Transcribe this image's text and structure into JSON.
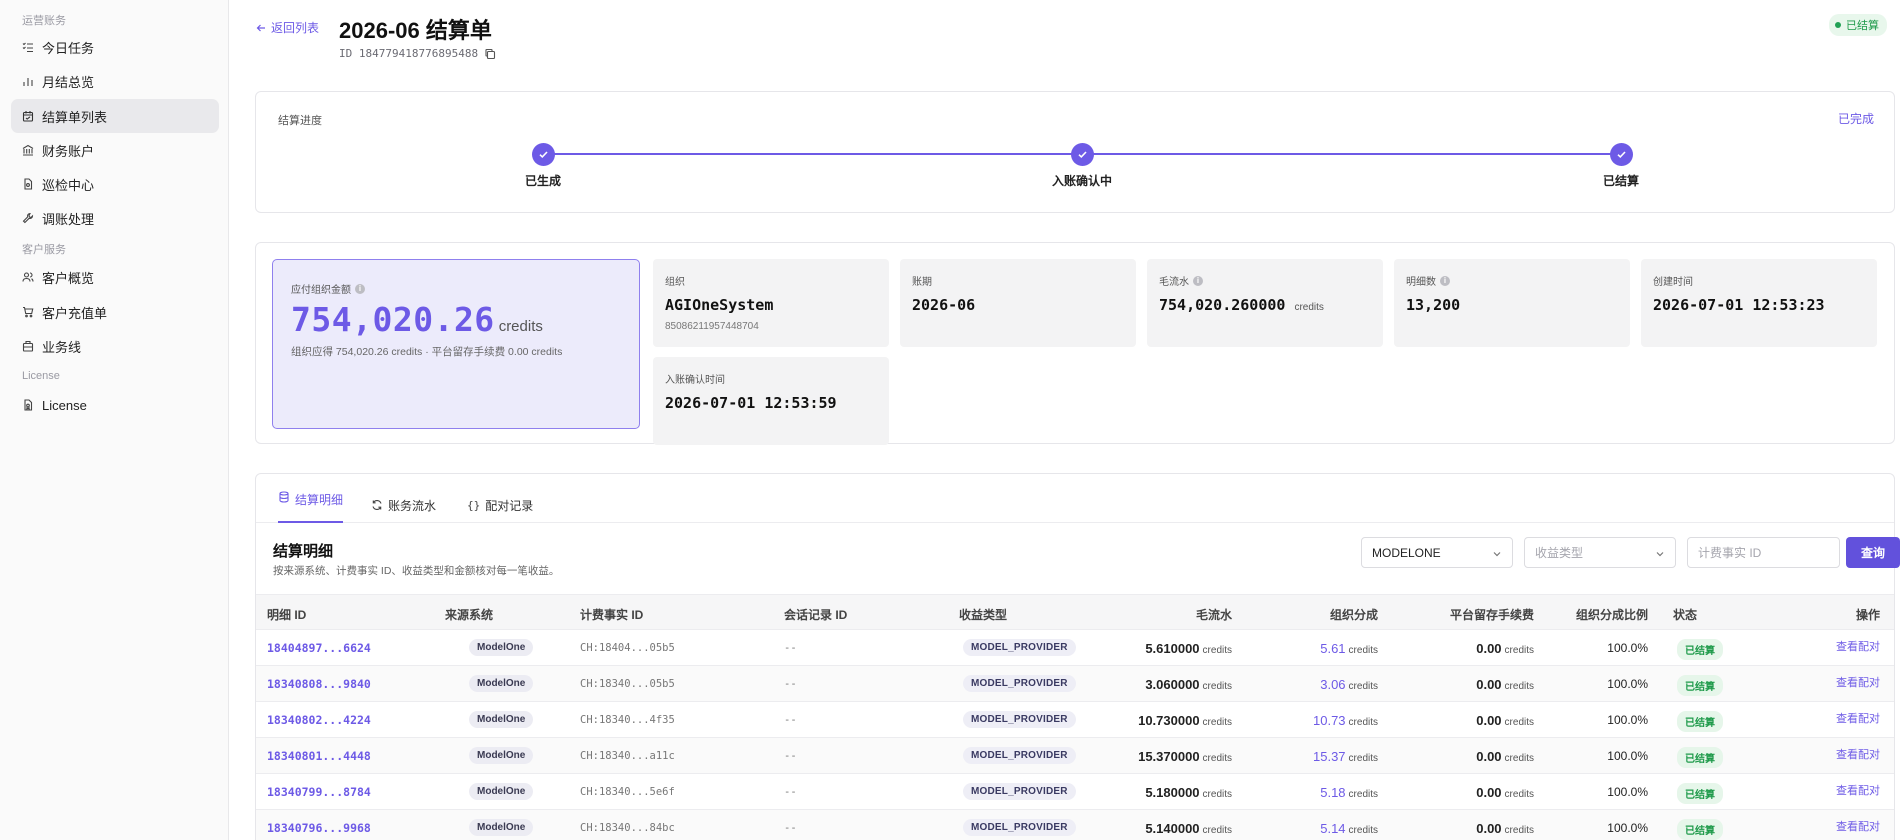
{
  "sidebar": {
    "sections": [
      "运营账务",
      "客户服务",
      "License"
    ],
    "items": [
      {
        "label": "今日任务",
        "icon": "list-check-icon"
      },
      {
        "label": "月结总览",
        "icon": "bar-chart-icon"
      },
      {
        "label": "结算单列表",
        "icon": "calendar-icon",
        "active": true
      },
      {
        "label": "财务账户",
        "icon": "bank-icon"
      },
      {
        "label": "巡检中心",
        "icon": "file-icon"
      },
      {
        "label": "调账处理",
        "icon": "wrench-icon"
      },
      {
        "label": "客户概览",
        "icon": "users-icon"
      },
      {
        "label": "客户充值单",
        "icon": "cart-icon"
      },
      {
        "label": "业务线",
        "icon": "building-icon"
      },
      {
        "label": "License",
        "icon": "license-icon"
      }
    ]
  },
  "header": {
    "back_label": "返回列表",
    "title": "2026-06 结算单",
    "id_text": "ID 184779418776895488",
    "status": "已结算"
  },
  "progress": {
    "title": "结算进度",
    "done_label": "已完成",
    "steps": [
      "已生成",
      "入账确认中",
      "已结算"
    ]
  },
  "summary": {
    "primary": {
      "label": "应付组织金额",
      "value": "754,020.26",
      "unit": "credits",
      "sub": "组织应得 754,020.26 credits · 平台留存手续费 0.00 credits"
    },
    "stats": [
      {
        "label": "组织",
        "value": "AGIOneSystem",
        "sub": "85086211957448704"
      },
      {
        "label": "账期",
        "value": "2026-06"
      },
      {
        "label": "毛流水",
        "value": "754,020.260000",
        "unit": "credits",
        "info": true
      },
      {
        "label": "明细数",
        "value": "13,200",
        "info": true
      },
      {
        "label": "创建时间",
        "value": "2026-07-01 12:53:23"
      },
      {
        "label": "入账确认时间",
        "value": "2026-07-01 12:53:59"
      }
    ]
  },
  "details": {
    "tabs": [
      "结算明细",
      "账务流水",
      "配对记录"
    ],
    "title": "结算明细",
    "subtitle": "按来源系统、计费事实 ID、收益类型和金额核对每一笔收益。",
    "filters": {
      "system_value": "MODELONE",
      "type_placeholder": "收益类型",
      "fact_placeholder": "计费事实 ID",
      "query_label": "查询"
    },
    "columns": [
      "明细 ID",
      "来源系统",
      "计费事实 ID",
      "会话记录 ID",
      "收益类型",
      "毛流水",
      "组织分成",
      "平台留存手续费",
      "组织分成比例",
      "状态",
      "操作"
    ],
    "unit": "credits",
    "rows": [
      {
        "id": "18404897...6624",
        "system": "ModelOne",
        "fact": "CH:18404...05b5",
        "session": "--",
        "type": "MODEL_PROVIDER",
        "gross": "5.610000",
        "org": "5.61",
        "fee": "0.00",
        "ratio": "100.0%",
        "status": "已结算",
        "action": "查看配对"
      },
      {
        "id": "18340808...9840",
        "system": "ModelOne",
        "fact": "CH:18340...05b5",
        "session": "--",
        "type": "MODEL_PROVIDER",
        "gross": "3.060000",
        "org": "3.06",
        "fee": "0.00",
        "ratio": "100.0%",
        "status": "已结算",
        "action": "查看配对"
      },
      {
        "id": "18340802...4224",
        "system": "ModelOne",
        "fact": "CH:18340...4f35",
        "session": "--",
        "type": "MODEL_PROVIDER",
        "gross": "10.730000",
        "org": "10.73",
        "fee": "0.00",
        "ratio": "100.0%",
        "status": "已结算",
        "action": "查看配对"
      },
      {
        "id": "18340801...4448",
        "system": "ModelOne",
        "fact": "CH:18340...a11c",
        "session": "--",
        "type": "MODEL_PROVIDER",
        "gross": "15.370000",
        "org": "15.37",
        "fee": "0.00",
        "ratio": "100.0%",
        "status": "已结算",
        "action": "查看配对"
      },
      {
        "id": "18340799...8784",
        "system": "ModelOne",
        "fact": "CH:18340...5e6f",
        "session": "--",
        "type": "MODEL_PROVIDER",
        "gross": "5.180000",
        "org": "5.18",
        "fee": "0.00",
        "ratio": "100.0%",
        "status": "已结算",
        "action": "查看配对"
      },
      {
        "id": "18340796...9968",
        "system": "ModelOne",
        "fact": "CH:18340...84bc",
        "session": "--",
        "type": "MODEL_PROVIDER",
        "gross": "5.140000",
        "org": "5.14",
        "fee": "0.00",
        "ratio": "100.0%",
        "status": "已结算",
        "action": "查看配对"
      }
    ]
  },
  "colors": {
    "accent": "#6d5ae6",
    "success": "#1e9a4a"
  }
}
